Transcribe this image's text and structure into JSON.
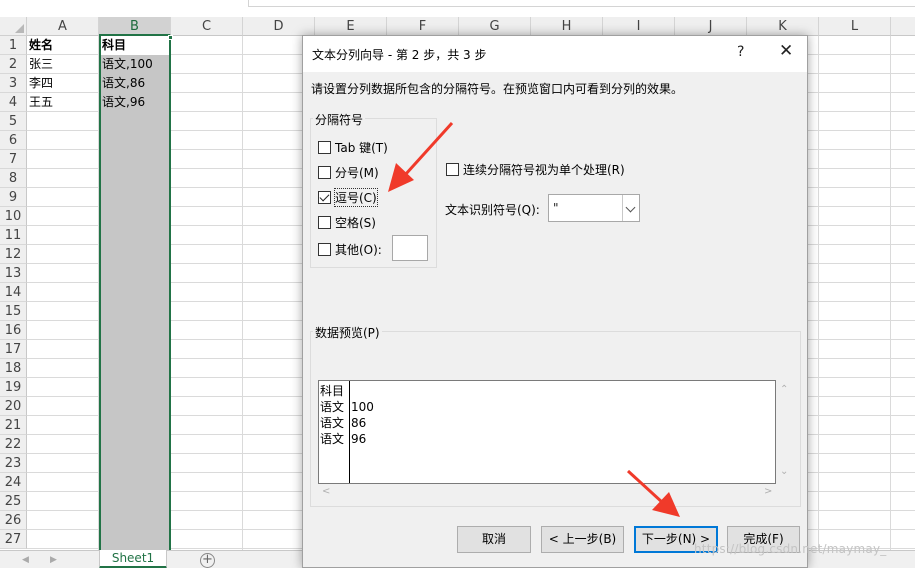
{
  "spreadsheet": {
    "columns": [
      "A",
      "B",
      "C",
      "D",
      "E",
      "F",
      "G",
      "H",
      "I",
      "J",
      "K",
      "L"
    ],
    "selected_column": "B",
    "rows": [
      "1",
      "2",
      "3",
      "4",
      "5",
      "6",
      "7",
      "8",
      "9",
      "10",
      "11",
      "12",
      "13",
      "14",
      "15",
      "16",
      "17",
      "18",
      "19",
      "20",
      "21",
      "22",
      "23",
      "24",
      "25",
      "26",
      "27"
    ],
    "cells": {
      "A1": "姓名",
      "B1": "科目",
      "A2": "张三",
      "B2": "语文,100",
      "A3": "李四",
      "B3": "语文,86",
      "A4": "王五",
      "B4": "语文,96"
    },
    "sheet_tab": "Sheet1",
    "add_sheet_icon": "plus-circle-icon",
    "accent_color": "#217346"
  },
  "dialog": {
    "title": "文本分列向导 - 第 2 步，共 3 步",
    "help": "?",
    "close": "✕",
    "description": "请设置分列数据所包含的分隔符号。在预览窗口内可看到分列的效果。",
    "delimiters": {
      "group_label": "分隔符号",
      "tab": {
        "label": "Tab 键(T)",
        "checked": false
      },
      "semicolon": {
        "label": "分号(M)",
        "checked": false
      },
      "comma": {
        "label": "逗号(C)",
        "checked": true
      },
      "space": {
        "label": "空格(S)",
        "checked": false
      },
      "other": {
        "label": "其他(O):",
        "checked": false,
        "value": ""
      }
    },
    "consecutive": {
      "label": "连续分隔符号视为单个处理(R)",
      "checked": false
    },
    "text_qualifier": {
      "label": "文本识别符号(Q):",
      "value": "\""
    },
    "preview": {
      "group_label": "数据预览(P)",
      "col1": [
        "科目",
        "语文",
        "语文",
        "语文"
      ],
      "col2": [
        "",
        "100",
        "86",
        "96"
      ]
    },
    "buttons": {
      "cancel": "取消",
      "back": "< 上一步(B)",
      "next": "下一步(N) >",
      "finish": "完成(F)"
    }
  },
  "watermark": "https://blog.csdn.net/maymay_",
  "annotation_color": "#f03a2a"
}
